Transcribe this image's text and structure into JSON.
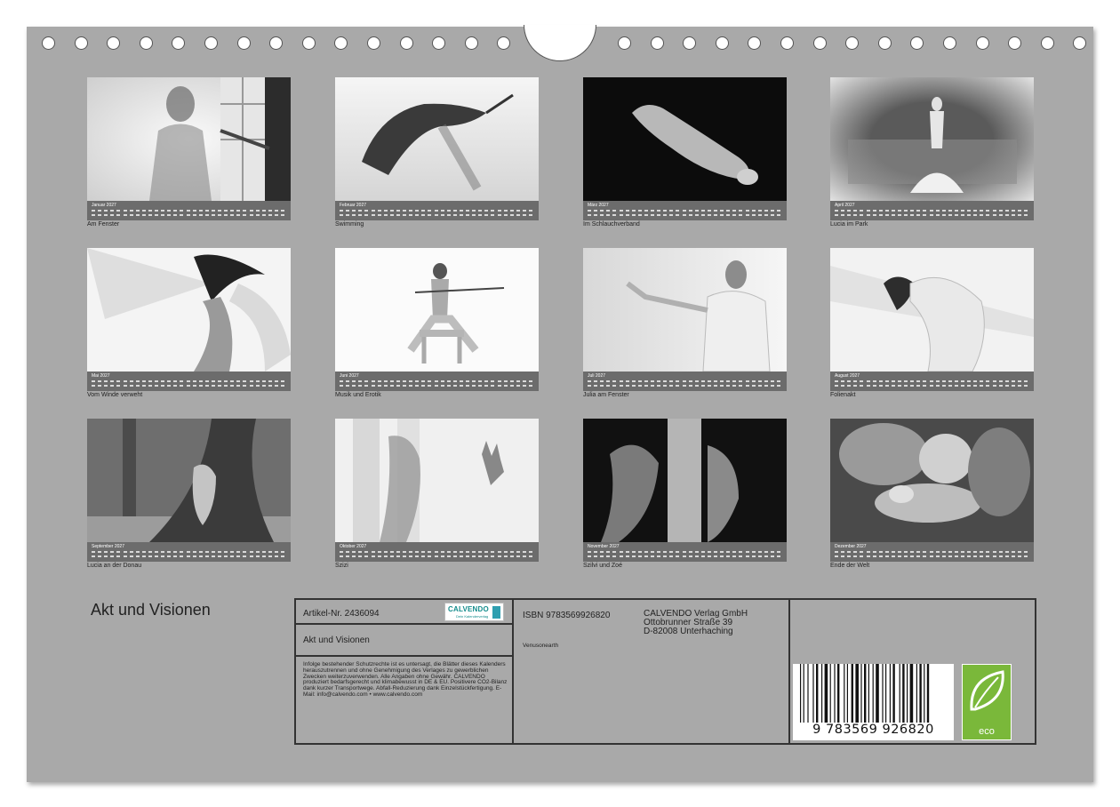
{
  "months": [
    {
      "name": "Januar 2027",
      "caption": "Am Fenster"
    },
    {
      "name": "Februar 2027",
      "caption": "Swimming"
    },
    {
      "name": "März 2027",
      "caption": "Im Schlauchverband"
    },
    {
      "name": "April 2027",
      "caption": "Lucia im Park"
    },
    {
      "name": "Mai 2027",
      "caption": "Vom Winde verweht"
    },
    {
      "name": "Juni 2027",
      "caption": "Musik und Erotik"
    },
    {
      "name": "Juli 2027",
      "caption": "Julia am Fenster"
    },
    {
      "name": "August 2027",
      "caption": "Folienakt"
    },
    {
      "name": "September 2027",
      "caption": "Lucia an der Donau"
    },
    {
      "name": "Oktober 2027",
      "caption": "Szizi"
    },
    {
      "name": "November 2027",
      "caption": "Szilvi und Zoé"
    },
    {
      "name": "Dezember 2027",
      "caption": "Ende der Welt"
    }
  ],
  "title": "Akt und Visionen",
  "info": {
    "article_number": "Artikel-Nr. 2436094",
    "logo_text": "CALVENDO",
    "logo_sub": "Dein Kalenderverlag",
    "book_title": "Akt und Visionen",
    "legal": "Infolge bestehender Schutzrechte ist es untersagt, die Blätter dieses Kalenders herauszutrennen und ohne Genehmigung des Verlages zu gewerblichen Zwecken weiterzuverwenden. Alle Angaben ohne Gewähr. CALVENDO produziert bedarfsgerecht und klimabewusst in DE & EU. Positivere CO2-Bilanz dank kurzer Transportwege. Abfall-Reduzierung dank Einzelstückfertigung. E-Mail: info@calvendo.com • www.calvendo.com",
    "isbn": "ISBN 9783569926820",
    "publisher_name": "CALVENDO Verlag GmbH",
    "publisher_street": "Ottobrunner Straße 39",
    "publisher_city": "D-82008 Unterhaching",
    "author": "Venusonearth",
    "barcode_number": "9 783569 926820",
    "eco_label": "eco"
  }
}
